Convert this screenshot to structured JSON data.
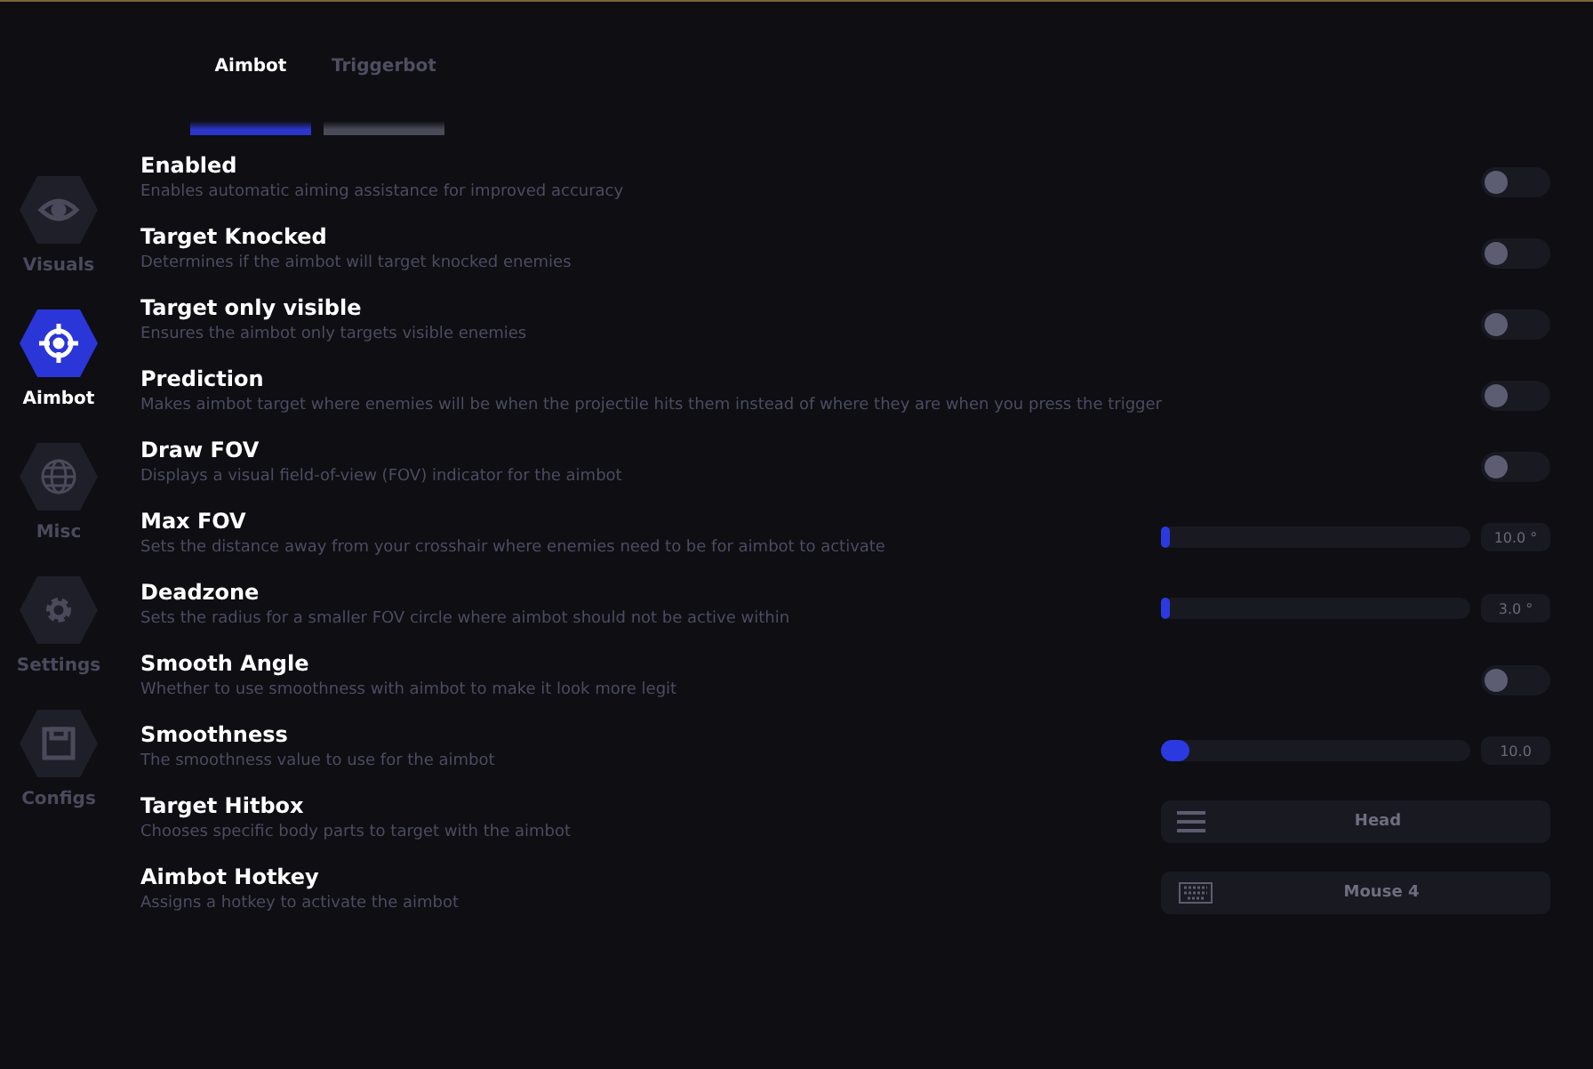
{
  "sidebar": {
    "items": [
      {
        "label": "Visuals",
        "kind": "eye",
        "selected": false
      },
      {
        "label": "Aimbot",
        "kind": "crosshair",
        "selected": true
      },
      {
        "label": "Misc",
        "kind": "globe",
        "selected": false
      },
      {
        "label": "Settings",
        "kind": "gear",
        "selected": false
      },
      {
        "label": "Configs",
        "kind": "save",
        "selected": false
      }
    ]
  },
  "tabs": [
    {
      "label": "Aimbot",
      "selected": true
    },
    {
      "label": "Triggerbot",
      "selected": false
    }
  ],
  "settings": [
    {
      "kind": "toggle",
      "title": "Enabled",
      "description": "Enables automatic aiming assistance for improved accuracy",
      "on": false
    },
    {
      "kind": "toggle",
      "title": "Target Knocked",
      "description": "Determines if the aimbot will target knocked enemies",
      "on": false
    },
    {
      "kind": "toggle",
      "title": "Target only visible",
      "description": "Ensures the aimbot only targets visible enemies",
      "on": false
    },
    {
      "kind": "toggle",
      "title": "Prediction",
      "description": "Makes aimbot target where enemies will be when the projectile hits them instead of where they are when you press the trigger",
      "on": false
    },
    {
      "kind": "toggle",
      "title": "Draw FOV",
      "description": "Displays a visual field-of-view (FOV) indicator for the aimbot",
      "on": false
    },
    {
      "kind": "slider",
      "title": "Max FOV",
      "description": "Sets the distance away from your crosshair where enemies need to be for aimbot to activate",
      "level": 0.03,
      "reading": "10.0 °"
    },
    {
      "kind": "slider",
      "title": "Deadzone",
      "description": "Sets the radius for a smaller FOV circle where aimbot should not be active within",
      "level": 0.03,
      "reading": "3.0 °"
    },
    {
      "kind": "toggle",
      "title": "Smooth Angle",
      "description": "Whether to use smoothness with aimbot to make it look more legit",
      "on": false
    },
    {
      "kind": "slider",
      "title": "Smoothness",
      "description": "The smoothness value to use for the aimbot",
      "level": 0.09,
      "reading": "10.0"
    },
    {
      "kind": "select",
      "title": "Target Hitbox",
      "description": "Chooses specific body parts to target with the aimbot",
      "value": "Head"
    },
    {
      "kind": "hotkey",
      "title": "Aimbot Hotkey",
      "description": "Assigns a hotkey to activate the aimbot",
      "value": "Mouse 4"
    }
  ]
}
